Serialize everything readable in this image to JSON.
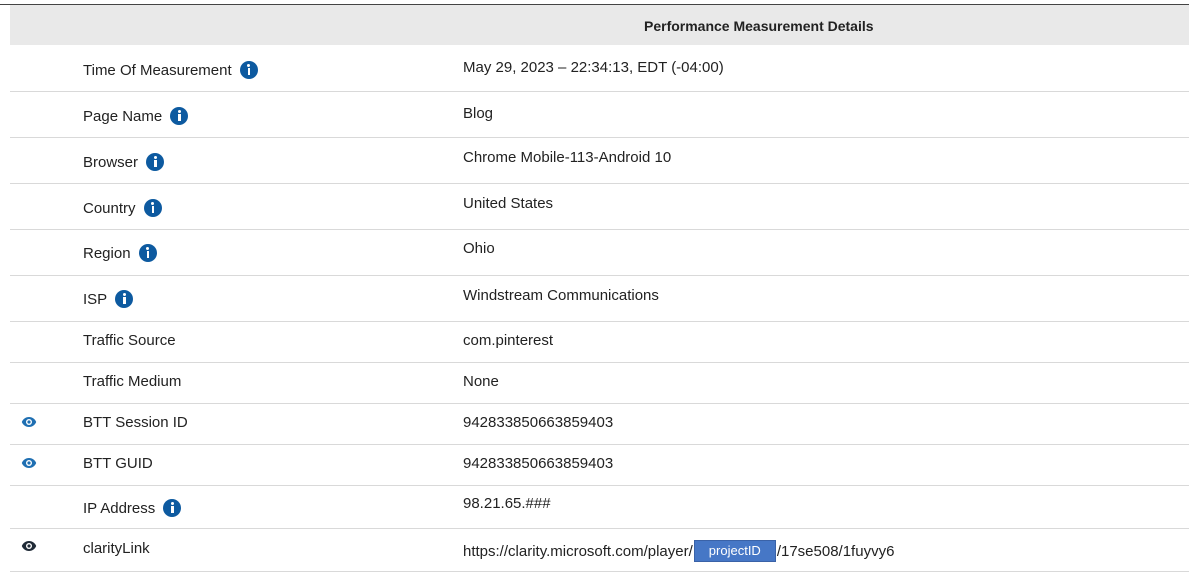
{
  "table": {
    "title": "Performance Measurement Details",
    "rows": [
      {
        "label": "Time Of Measurement",
        "value": "May 29, 2023 – 22:34:13, EDT (-04:00)"
      },
      {
        "label": "Page Name",
        "value": "Blog"
      },
      {
        "label": "Browser",
        "value": "Chrome Mobile-113-Android 10"
      },
      {
        "label": "Country",
        "value": "United States"
      },
      {
        "label": "Region",
        "value": "Ohio"
      },
      {
        "label": "ISP",
        "value": "Windstream Communications"
      },
      {
        "label": "Traffic Source",
        "value": "com.pinterest"
      },
      {
        "label": "Traffic Medium",
        "value": "None"
      },
      {
        "label": "BTT Session ID",
        "value": "942833850663859403"
      },
      {
        "label": "BTT GUID",
        "value": "942833850663859403"
      },
      {
        "label": "IP Address",
        "value": "98.21.65.###"
      },
      {
        "label": "clarityLink",
        "value_prefix": "https://clarity.microsoft.com/player/",
        "redacted": "projectID",
        "value_suffix": "/17se508/1fuyvy6"
      }
    ]
  },
  "icons": {
    "info": "info-circle-icon",
    "eye": "eye-icon"
  },
  "colors": {
    "info": "#0d5aa0",
    "eye": "#1f6fb2",
    "header_bg": "#e9e9e9",
    "redaction": "#4677c6"
  }
}
